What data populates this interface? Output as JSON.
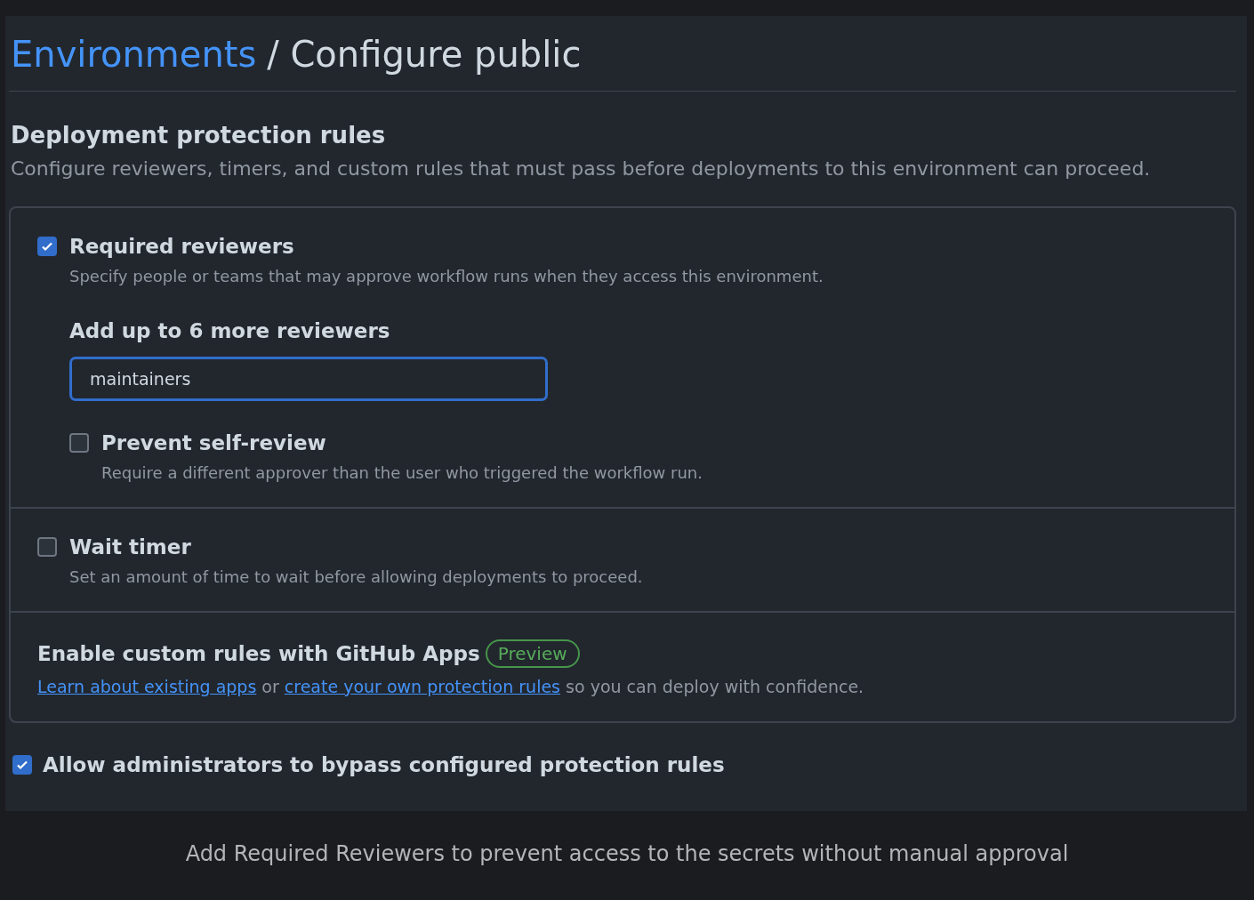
{
  "header": {
    "link": "Environments",
    "title": "/ Configure public"
  },
  "section": {
    "title": "Deployment protection rules",
    "description": "Configure reviewers, timers, and custom rules that must pass before deployments to this environment can proceed."
  },
  "rules": [
    {
      "kind": "reviewers",
      "label": "Required reviewers",
      "checked": true,
      "description": "Specify people or teams that may approve workflow runs when they access this environment.",
      "reviewers_label": "Add up to 6 more reviewers",
      "reviewers_value": "maintainers",
      "self_review": {
        "label": "Prevent self-review",
        "checked": false,
        "description": "Require a different approver than the user who triggered the workflow run."
      }
    },
    {
      "kind": "timer",
      "label": "Wait timer",
      "checked": false,
      "description": "Set an amount of time to wait before allowing deployments to proceed."
    },
    {
      "kind": "apps",
      "title": "Enable custom rules with GitHub Apps",
      "badge": "Preview",
      "parts": [
        {
          "kind": "link",
          "text": "Learn about existing apps"
        },
        {
          "kind": "text",
          "text": " or "
        },
        {
          "kind": "link",
          "text": "create your own protection rules"
        },
        {
          "kind": "text",
          "text": " so you can deploy with confidence."
        }
      ]
    }
  ],
  "bypass": {
    "label": "Allow administrators to bypass configured protection rules",
    "checked": true
  },
  "caption": "Add Required Reviewers to prevent access to the secrets without manual approval"
}
